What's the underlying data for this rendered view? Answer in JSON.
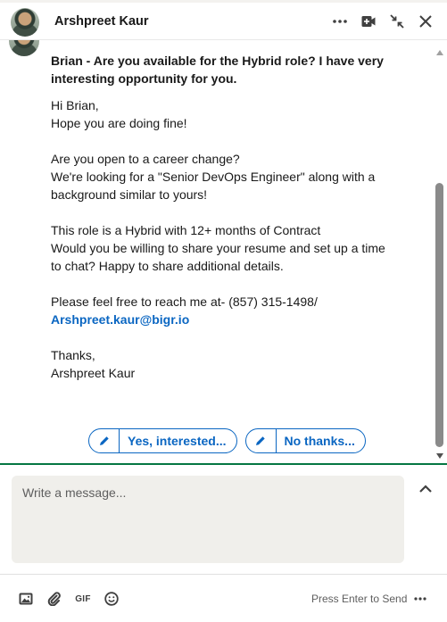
{
  "header": {
    "contact_name": "Arshpreet Kaur",
    "icons": [
      "more-options-icon",
      "video-call-icon",
      "minimize-icon",
      "close-icon"
    ]
  },
  "message": {
    "subject": "Brian - Are you available for the Hybrid role? I have very interesting opportunity for you.",
    "lines": {
      "l1": "Hi Brian,",
      "l2": "Hope you are doing fine!",
      "l3": "Are you open to a career change?",
      "l4": "We're looking for a \"Senior DevOps Engineer\" along with a background similar to yours!",
      "l5": "This role is a Hybrid with 12+ months of Contract",
      "l6": "Would you be willing to share your resume and set up a time to chat? Happy to share additional details.",
      "l7_prefix": "Please feel free to reach me at- (857) 315-1498/",
      "email": "Arshpreet.kaur@bigr.io",
      "l8": "Thanks,",
      "l9": "Arshpreet Kaur"
    }
  },
  "quick_replies": {
    "yes": "Yes, interested...",
    "no": "No thanks..."
  },
  "compose": {
    "placeholder": "Write a message..."
  },
  "footer": {
    "gif_label": "GIF",
    "send_hint": "Press Enter to Send"
  },
  "colors": {
    "accent": "#0a66c2",
    "divider_green": "#057642",
    "compose_bg": "#f0efeb"
  }
}
